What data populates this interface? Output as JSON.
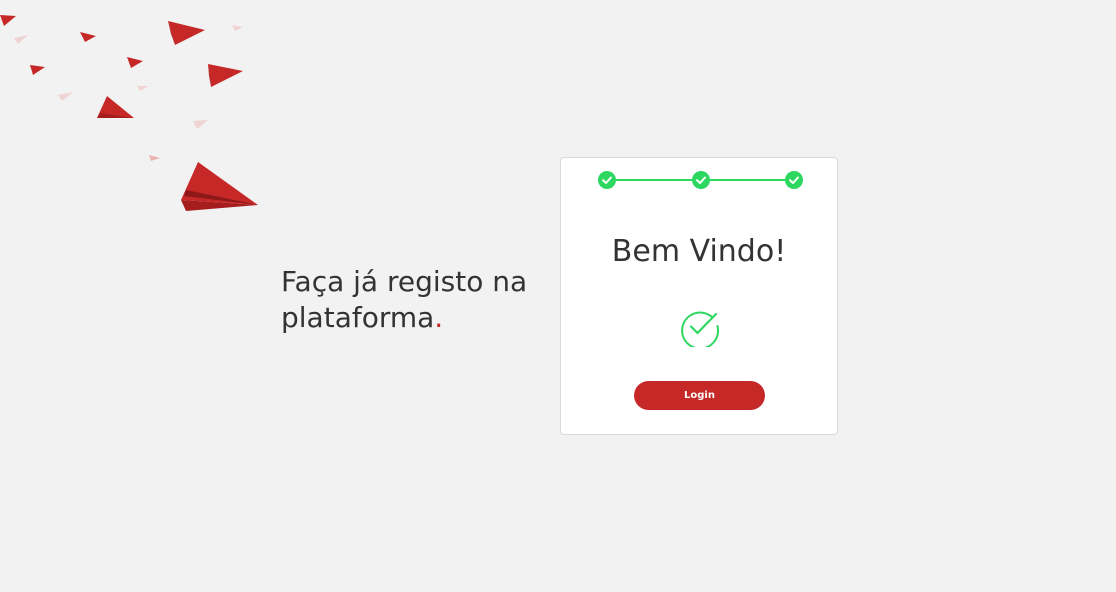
{
  "hero": {
    "tagline_main": "Faça já registo na plataforma",
    "tagline_dot": "."
  },
  "card": {
    "title": "Bem Vindo!",
    "login_label": "Login",
    "steps_completed": 3,
    "steps_total": 3
  },
  "colors": {
    "background": "#f3f2f2",
    "brand_red": "#c62828",
    "success_green": "#2ed860",
    "text_dark": "#333333"
  }
}
